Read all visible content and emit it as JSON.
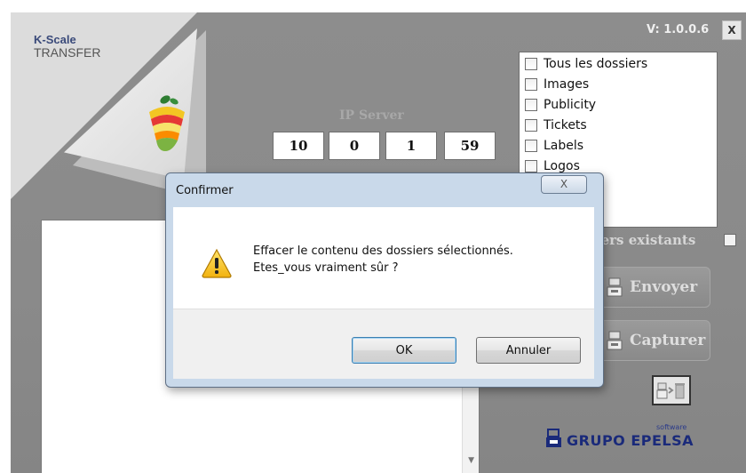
{
  "app": {
    "brand_line1": "K-Scale",
    "brand_line2": "TRANSFER",
    "version": "V: 1.0.0.6",
    "close_label": "X",
    "ip": {
      "title": "IP Server",
      "octets": [
        "10",
        "0",
        "1",
        "59"
      ]
    },
    "folders": [
      {
        "label": "Tous les dossiers"
      },
      {
        "label": "Images"
      },
      {
        "label": "Publicity"
      },
      {
        "label": "Tickets"
      },
      {
        "label": "Labels"
      },
      {
        "label": "Logos"
      }
    ],
    "existing_label": "hiers existants",
    "send_label": "Envoyer",
    "capture_label": "Capturer",
    "company": {
      "software": "software",
      "name": "GRUPO EPELSA"
    },
    "colors": {
      "background": "#8a8a8a",
      "brand_blue": "#1a2a7a"
    }
  },
  "dialog": {
    "title": "Confirmer",
    "close_label": "X",
    "icon": "warning-icon",
    "message_line1": "Effacer le contenu des dossiers sélectionnés.",
    "message_line2": "Etes_vous vraiment sûr ?",
    "ok_label": "OK",
    "cancel_label": "Annuler"
  }
}
